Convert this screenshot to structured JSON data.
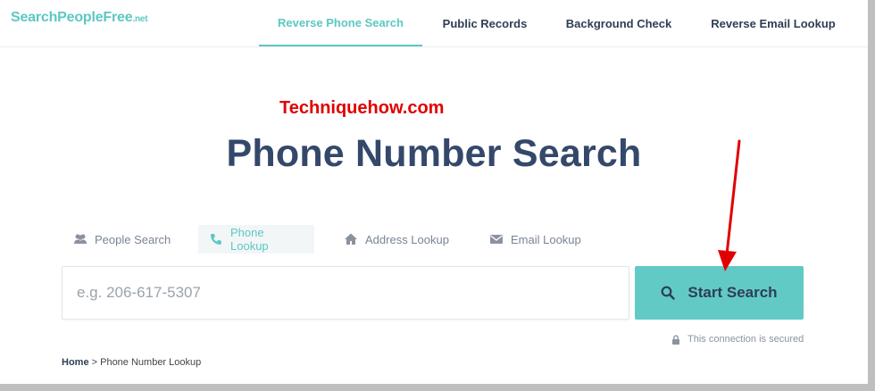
{
  "header": {
    "logo_main": "SearchPeopleFree",
    "logo_suffix": ".net",
    "nav": [
      {
        "label": "Reverse Phone Search",
        "active": true
      },
      {
        "label": "Public Records"
      },
      {
        "label": "Background Check"
      },
      {
        "label": "Reverse Email Lookup"
      }
    ]
  },
  "watermark": "Techniquehow.com",
  "title": "Phone Number Search",
  "tabs": [
    {
      "label": "People Search",
      "icon": "people-icon"
    },
    {
      "label": "Phone Lookup",
      "icon": "phone-icon",
      "active": true
    },
    {
      "label": "Address Lookup",
      "icon": "home-icon"
    },
    {
      "label": "Email Lookup",
      "icon": "envelope-icon"
    }
  ],
  "search": {
    "placeholder": "e.g. 206-617-5307",
    "value": "",
    "button_label": "Start Search",
    "button_icon": "search-icon"
  },
  "secure_text": "This connection is secured",
  "breadcrumb": {
    "home": "Home",
    "separator": " > ",
    "current": "Phone Number Lookup"
  },
  "colors": {
    "accent": "#5cc8c3",
    "title": "#34486b",
    "watermark": "#e00000"
  }
}
